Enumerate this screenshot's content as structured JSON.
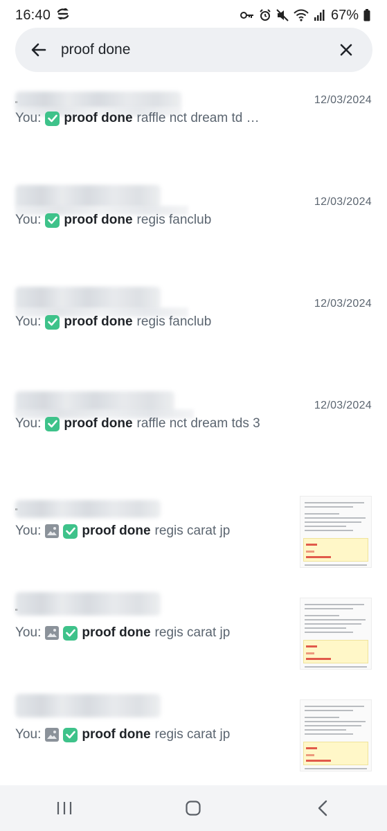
{
  "status_bar": {
    "time": "16:40",
    "battery": "67%",
    "icons": [
      "sync-icon",
      "key-icon",
      "alarm-icon",
      "mute-icon",
      "wifi-icon",
      "signal-icon",
      "battery-icon"
    ]
  },
  "search": {
    "query": "proof done",
    "back_icon": "back-arrow-icon",
    "clear_icon": "close-icon"
  },
  "results": [
    {
      "date": "12/03/2024",
      "prefix": "You:",
      "has_photo": false,
      "keyword": "proof done",
      "rest": "raffle nct dream td …",
      "has_thumbnail": false
    },
    {
      "date": "12/03/2024",
      "prefix": "You:",
      "has_photo": false,
      "keyword": "proof done",
      "rest": "regis fanclub",
      "has_thumbnail": false
    },
    {
      "date": "12/03/2024",
      "prefix": "You:",
      "has_photo": false,
      "keyword": "proof done",
      "rest": "regis fanclub",
      "has_thumbnail": false
    },
    {
      "date": "12/03/2024",
      "prefix": "You:",
      "has_photo": false,
      "keyword": "proof done",
      "rest": "raffle nct dream tds 3",
      "has_thumbnail": false
    },
    {
      "date": "",
      "prefix": "You:",
      "has_photo": true,
      "keyword": "proof done",
      "rest": "regis carat jp",
      "has_thumbnail": true
    },
    {
      "date": "",
      "prefix": "You:",
      "has_photo": true,
      "keyword": "proof done",
      "rest": "regis carat jp",
      "has_thumbnail": true
    },
    {
      "date": "",
      "prefix": "You:",
      "has_photo": true,
      "keyword": "proof done",
      "rest": "regis carat jp",
      "has_thumbnail": true
    }
  ],
  "nav_bar": {
    "icons": [
      "recent-apps-icon",
      "home-icon",
      "back-icon"
    ]
  },
  "colors": {
    "check_green": "#3ec28a",
    "search_bg": "#eef0f3",
    "secondary_text": "#5b6570"
  }
}
